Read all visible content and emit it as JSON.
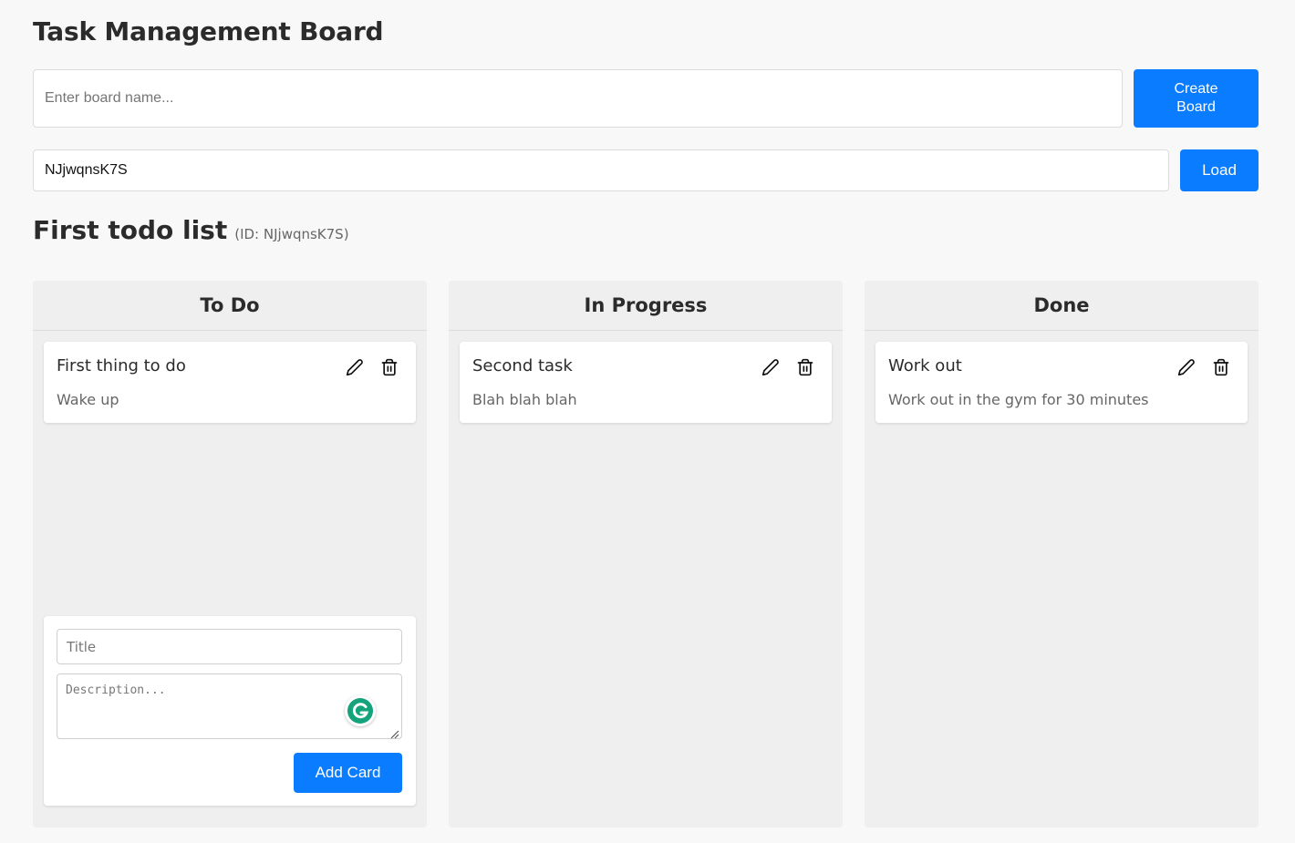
{
  "header": {
    "title": "Task Management Board"
  },
  "create_board": {
    "placeholder": "Enter board name...",
    "button_label": "Create Board"
  },
  "load_board": {
    "value": "NJjwqnsK7S",
    "button_label": "Load"
  },
  "board": {
    "name": "First todo list",
    "id_label": "(ID: NJjwqnsK7S)"
  },
  "columns": [
    {
      "title": "To Do",
      "cards": [
        {
          "title": "First thing to do",
          "description": "Wake up"
        }
      ]
    },
    {
      "title": "In Progress",
      "cards": [
        {
          "title": "Second task",
          "description": "Blah blah blah"
        }
      ]
    },
    {
      "title": "Done",
      "cards": [
        {
          "title": "Work out",
          "description": "Work out in the gym for 30 minutes"
        }
      ]
    }
  ],
  "add_card_form": {
    "title_placeholder": "Title",
    "description_placeholder": "Description...",
    "button_label": "Add Card"
  },
  "icons": {
    "edit": "pencil-icon",
    "delete": "trash-icon",
    "grammarly": "grammarly-icon"
  },
  "colors": {
    "accent": "#0a7cff",
    "page_background": "#f8f8f8",
    "column_background": "#efefef",
    "grammarly_green": "#15c39a"
  }
}
